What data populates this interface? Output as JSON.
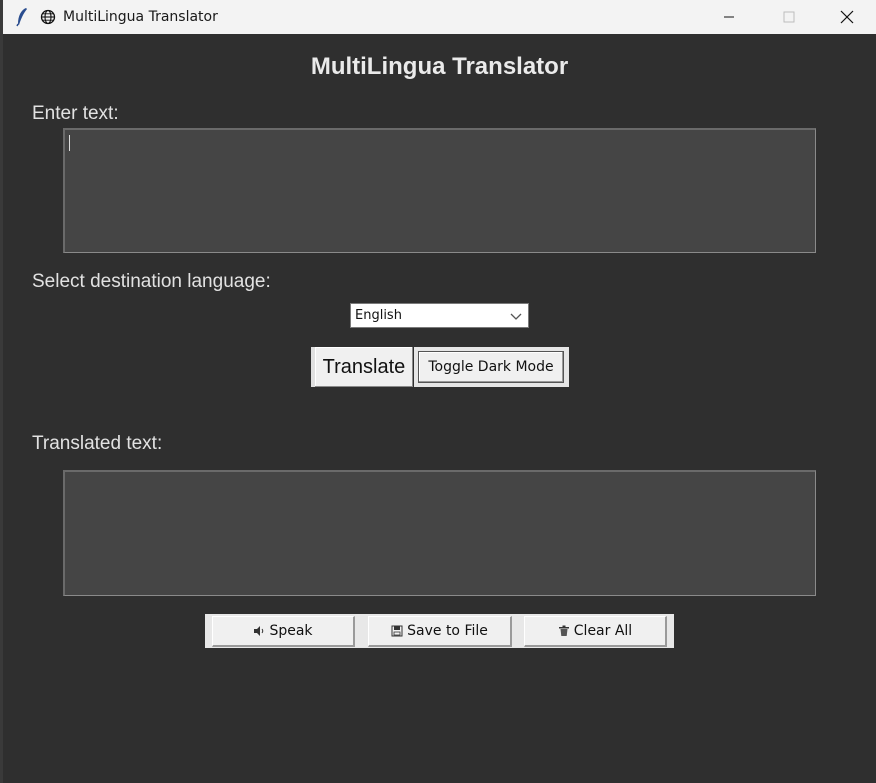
{
  "window": {
    "title": "MultiLingua Translator"
  },
  "app": {
    "heading": "MultiLingua Translator",
    "enter_label": "Enter text:",
    "input_value": "",
    "select_label": "Select destination language:",
    "language": {
      "selected": "English"
    },
    "translate_label": "Translate",
    "toggle_label": "Toggle Dark Mode",
    "translated_label": "Translated text:",
    "output_value": "",
    "speak_label": "Speak",
    "save_label": "Save to File",
    "clear_label": "Clear All"
  },
  "icons": {
    "app": "feather-icon",
    "globe": "globe-icon",
    "speak": "speaker-icon",
    "save": "floppy-disk-icon",
    "clear": "trash-icon"
  },
  "colors": {
    "background": "#2f2f2f",
    "textarea": "#454545",
    "text": "#e2e2e2"
  }
}
